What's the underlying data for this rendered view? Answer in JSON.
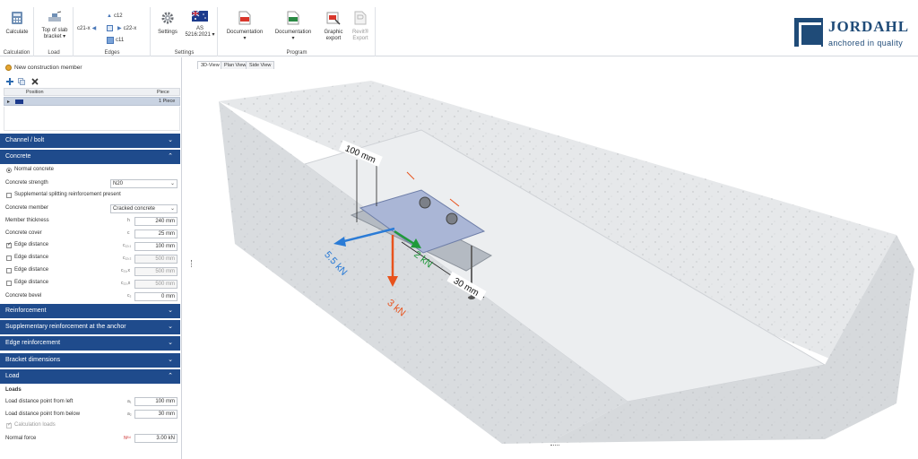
{
  "ribbon": {
    "calculate": "Calculate",
    "calculation_group": "Calculation",
    "top_of_slab": "Top of slab",
    "bracket": "bracket",
    "load_group": "Load",
    "edges": {
      "c12": "c12",
      "c21x": "c21-x",
      "c22x": "c22-x",
      "c11": "c11",
      "group": "Edges"
    },
    "settings": "Settings",
    "standard_country": "AS",
    "standard_code": "5216:2021",
    "settings_group": "Settings",
    "documentation1": "Documentation",
    "documentation2": "Documentation",
    "graphic": "Graphic",
    "graphic2": "export",
    "revit": "Revit®",
    "revit2": "Export",
    "program_group": "Program"
  },
  "brand": {
    "name": "JORDAHL",
    "tagline": "anchored in quality",
    "color": "#1f4b78"
  },
  "panel": {
    "new_member": "New construction member",
    "grid": {
      "col_position": "Position",
      "col_piece": "Piece",
      "row_piece": "1 Piece"
    },
    "sections": {
      "channel_bolt": "Channel / bolt",
      "concrete": "Concrete",
      "reinforcement": "Reinforcement",
      "supp_anchor": "Supplementary reinforcement at the anchor",
      "edge_reinf": "Edge reinforcement",
      "bracket_dims": "Bracket dimensions",
      "load": "Load"
    },
    "concrete": {
      "normal": "Normal concrete",
      "strength_label": "Concrete strength",
      "strength_value": "N20",
      "supp_split": "Supplemental splitting reinforcement present",
      "member_label": "Concrete member",
      "member_value": "Cracked concrete",
      "thickness_label": "Member thickness",
      "thickness_sym": "h",
      "thickness_value": "240 mm",
      "cover_label": "Concrete cover",
      "cover_sym": "c",
      "cover_value": "25 mm",
      "edge1_label": "Edge distance",
      "edge1_sym": "c₁₂,₁",
      "edge1_value": "100 mm",
      "edge2_label": "Edge distance",
      "edge2_sym": "c₁₂,₂",
      "edge2_value": "500 mm",
      "edge3_label": "Edge distance",
      "edge3_sym": "c₂₁,x",
      "edge3_value": "500 mm",
      "edge4_label": "Edge distance",
      "edge4_sym": "c₂₂,x",
      "edge4_value": "500 mm",
      "bevel_label": "Concrete bevel",
      "bevel_sym": "c₂",
      "bevel_value": "0 mm"
    },
    "load": {
      "heading": "Loads",
      "left_label": "Load distance point from left",
      "left_sym": "a₁",
      "left_value": "100 mm",
      "below_label": "Load distance point from below",
      "below_sym": "a₂",
      "below_value": "30 mm",
      "calc_loads": "Calculation loads",
      "normal_label": "Normal force",
      "normal_sym": "Nᴱᵈ",
      "normal_value": "3.00 kN"
    }
  },
  "viewer": {
    "tabs": [
      "3D-View",
      "Plan View",
      "Side View"
    ],
    "dims": {
      "d100": "100 mm",
      "d30": "30 mm"
    },
    "forces": {
      "blue": "5.5 kN",
      "green": "2 kN",
      "orange": "3 kN"
    },
    "colors": {
      "blue": "#2a7bd6",
      "green": "#1f9a3a",
      "orange": "#e8521c"
    }
  }
}
